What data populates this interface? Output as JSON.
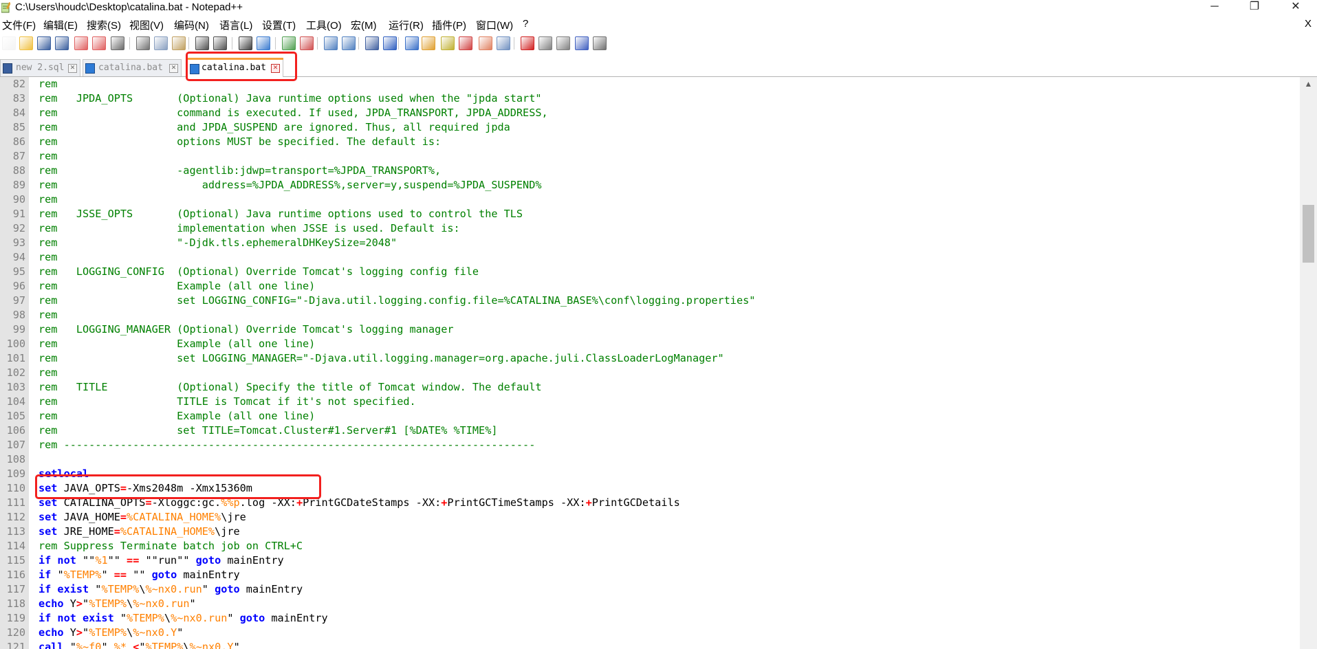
{
  "window": {
    "title": "C:\\Users\\houdc\\Desktop\\catalina.bat - Notepad++",
    "minimize": "─",
    "restore": "❐",
    "close": "✕"
  },
  "menu": {
    "items": [
      "文件(F)",
      "编辑(E)",
      "搜索(S)",
      "视图(V)",
      "编码(N)",
      "语言(L)",
      "设置(T)",
      "工具(O)",
      "宏(M)",
      "运行(R)",
      "插件(P)",
      "窗口(W)",
      "?"
    ],
    "close": "X"
  },
  "toolbar": {
    "icons": [
      {
        "name": "new-file-icon",
        "color": "#f4f4f4"
      },
      {
        "name": "open-file-icon",
        "color": "#f0c040"
      },
      {
        "name": "save-icon",
        "color": "#3a5f9e"
      },
      {
        "name": "save-all-icon",
        "color": "#3a5f9e"
      },
      {
        "name": "close-file-icon",
        "color": "#e06060"
      },
      {
        "name": "close-all-icon",
        "color": "#e06060"
      },
      {
        "name": "print-icon",
        "color": "#6a6a6a"
      },
      {
        "name": "cut-icon",
        "color": "#707070"
      },
      {
        "name": "copy-icon",
        "color": "#8aa0c0"
      },
      {
        "name": "paste-icon",
        "color": "#c0a060"
      },
      {
        "name": "undo-icon",
        "color": "#505050"
      },
      {
        "name": "redo-icon",
        "color": "#505050"
      },
      {
        "name": "find-icon",
        "color": "#404040"
      },
      {
        "name": "replace-icon",
        "color": "#3b7bd0"
      },
      {
        "name": "zoom-in-icon",
        "color": "#50a050"
      },
      {
        "name": "zoom-out-icon",
        "color": "#d05050"
      },
      {
        "name": "sync-vertical-icon",
        "color": "#5080c0"
      },
      {
        "name": "sync-horizontal-icon",
        "color": "#5080c0"
      },
      {
        "name": "word-wrap-icon",
        "color": "#4060a0"
      },
      {
        "name": "show-all-chars-icon",
        "color": "#3060c0"
      },
      {
        "name": "indent-guide-icon",
        "color": "#3a70c8"
      },
      {
        "name": "user-language-icon",
        "color": "#e0a030"
      },
      {
        "name": "doc-map-icon",
        "color": "#c0b030"
      },
      {
        "name": "function-list-icon",
        "color": "#d04040"
      },
      {
        "name": "folder-workspace-icon",
        "color": "#e08060"
      },
      {
        "name": "monitoring-icon",
        "color": "#7090c0"
      },
      {
        "name": "record-macro-icon",
        "color": "#d02020"
      },
      {
        "name": "stop-macro-icon",
        "color": "#808080"
      },
      {
        "name": "play-macro-icon",
        "color": "#808080"
      },
      {
        "name": "run-macro-multiple-icon",
        "color": "#4060c0"
      },
      {
        "name": "save-macro-icon",
        "color": "#707070"
      }
    ]
  },
  "tabs": [
    {
      "label": "new 2.sql",
      "active": false,
      "close": "✕"
    },
    {
      "label": "catalina.bat",
      "active": false,
      "close": "✕"
    },
    {
      "label": "catalina.bat",
      "active": true,
      "close": "✕"
    }
  ],
  "colors": {
    "comment": "#008000",
    "keyword": "#0000ff",
    "operator": "#ff0000",
    "variable": "#ff8000",
    "highlight_box": "#f2201e"
  },
  "editor": {
    "lines": [
      {
        "n": "82",
        "t": [
          [
            "c",
            "rem"
          ]
        ]
      },
      {
        "n": "83",
        "t": [
          [
            "c",
            "rem   JPDA_OPTS       (Optional) Java runtime options used when the \"jpda start\""
          ]
        ]
      },
      {
        "n": "84",
        "t": [
          [
            "c",
            "rem                   command is executed. If used, JPDA_TRANSPORT, JPDA_ADDRESS,"
          ]
        ]
      },
      {
        "n": "85",
        "t": [
          [
            "c",
            "rem                   and JPDA_SUSPEND are ignored. Thus, all required jpda"
          ]
        ]
      },
      {
        "n": "86",
        "t": [
          [
            "c",
            "rem                   options MUST be specified. The default is:"
          ]
        ]
      },
      {
        "n": "87",
        "t": [
          [
            "c",
            "rem"
          ]
        ]
      },
      {
        "n": "88",
        "t": [
          [
            "c",
            "rem                   -agentlib:jdwp=transport=%JPDA_TRANSPORT%,"
          ]
        ]
      },
      {
        "n": "89",
        "t": [
          [
            "c",
            "rem                       address=%JPDA_ADDRESS%,server=y,suspend=%JPDA_SUSPEND%"
          ]
        ]
      },
      {
        "n": "90",
        "t": [
          [
            "c",
            "rem"
          ]
        ]
      },
      {
        "n": "91",
        "t": [
          [
            "c",
            "rem   JSSE_OPTS       (Optional) Java runtime options used to control the TLS"
          ]
        ]
      },
      {
        "n": "92",
        "t": [
          [
            "c",
            "rem                   implementation when JSSE is used. Default is:"
          ]
        ]
      },
      {
        "n": "93",
        "t": [
          [
            "c",
            "rem                   \"-Djdk.tls.ephemeralDHKeySize=2048\""
          ]
        ]
      },
      {
        "n": "94",
        "t": [
          [
            "c",
            "rem"
          ]
        ]
      },
      {
        "n": "95",
        "t": [
          [
            "c",
            "rem   LOGGING_CONFIG  (Optional) Override Tomcat's logging config file"
          ]
        ]
      },
      {
        "n": "96",
        "t": [
          [
            "c",
            "rem                   Example (all one line)"
          ]
        ]
      },
      {
        "n": "97",
        "t": [
          [
            "c",
            "rem                   set LOGGING_CONFIG=\"-Djava.util.logging.config.file=%CATALINA_BASE%\\conf\\logging.properties\""
          ]
        ]
      },
      {
        "n": "98",
        "t": [
          [
            "c",
            "rem"
          ]
        ]
      },
      {
        "n": "99",
        "t": [
          [
            "c",
            "rem   LOGGING_MANAGER (Optional) Override Tomcat's logging manager"
          ]
        ]
      },
      {
        "n": "100",
        "t": [
          [
            "c",
            "rem                   Example (all one line)"
          ]
        ]
      },
      {
        "n": "101",
        "t": [
          [
            "c",
            "rem                   set LOGGING_MANAGER=\"-Djava.util.logging.manager=org.apache.juli.ClassLoaderLogManager\""
          ]
        ]
      },
      {
        "n": "102",
        "t": [
          [
            "c",
            "rem"
          ]
        ]
      },
      {
        "n": "103",
        "t": [
          [
            "c",
            "rem   TITLE           (Optional) Specify the title of Tomcat window. The default"
          ]
        ]
      },
      {
        "n": "104",
        "t": [
          [
            "c",
            "rem                   TITLE is Tomcat if it's not specified."
          ]
        ]
      },
      {
        "n": "105",
        "t": [
          [
            "c",
            "rem                   Example (all one line)"
          ]
        ]
      },
      {
        "n": "106",
        "t": [
          [
            "c",
            "rem                   set TITLE=Tomcat.Cluster#1.Server#1 [%DATE% %TIME%]"
          ]
        ]
      },
      {
        "n": "107",
        "t": [
          [
            "c",
            "rem ---------------------------------------------------------------------------"
          ]
        ]
      },
      {
        "n": "108",
        "t": []
      },
      {
        "n": "109",
        "t": [
          [
            "k",
            "setlocal"
          ]
        ]
      },
      {
        "n": "110",
        "t": [
          [
            "k",
            "set"
          ],
          [
            "x",
            " JAVA_OPTS"
          ],
          [
            "o",
            "="
          ],
          [
            "x",
            "-Xms2048m -Xmx15360m"
          ]
        ]
      },
      {
        "n": "111",
        "t": [
          [
            "k",
            "set"
          ],
          [
            "x",
            " CATALINA_OPTS"
          ],
          [
            "o",
            "="
          ],
          [
            "x",
            "-Xloggc:gc."
          ],
          [
            "v",
            "%%p"
          ],
          [
            "x",
            ".log -XX:"
          ],
          [
            "o",
            "+"
          ],
          [
            "x",
            "PrintGCDateStamps -XX:"
          ],
          [
            "o",
            "+"
          ],
          [
            "x",
            "PrintGCTimeStamps -XX:"
          ],
          [
            "o",
            "+"
          ],
          [
            "x",
            "PrintGCDetails"
          ]
        ]
      },
      {
        "n": "112",
        "t": [
          [
            "k",
            "set"
          ],
          [
            "x",
            " JAVA_HOME"
          ],
          [
            "o",
            "="
          ],
          [
            "v",
            "%CATALINA_HOME%"
          ],
          [
            "x",
            "\\jre"
          ]
        ]
      },
      {
        "n": "113",
        "t": [
          [
            "k",
            "set"
          ],
          [
            "x",
            " JRE_HOME"
          ],
          [
            "o",
            "="
          ],
          [
            "v",
            "%CATALINA_HOME%"
          ],
          [
            "x",
            "\\jre"
          ]
        ]
      },
      {
        "n": "114",
        "t": [
          [
            "c",
            "rem Suppress Terminate batch job on CTRL+C"
          ]
        ]
      },
      {
        "n": "115",
        "t": [
          [
            "k",
            "if not"
          ],
          [
            "x",
            " \"\""
          ],
          [
            "v",
            "%1"
          ],
          [
            "x",
            "\"\" "
          ],
          [
            "o",
            "=="
          ],
          [
            "x",
            " \"\"run\"\" "
          ],
          [
            "k",
            "goto"
          ],
          [
            "x",
            " mainEntry"
          ]
        ]
      },
      {
        "n": "116",
        "t": [
          [
            "k",
            "if"
          ],
          [
            "x",
            " \""
          ],
          [
            "v",
            "%TEMP%"
          ],
          [
            "x",
            "\" "
          ],
          [
            "o",
            "=="
          ],
          [
            "x",
            " \"\" "
          ],
          [
            "k",
            "goto"
          ],
          [
            "x",
            " mainEntry"
          ]
        ]
      },
      {
        "n": "117",
        "t": [
          [
            "k",
            "if exist"
          ],
          [
            "x",
            " \""
          ],
          [
            "v",
            "%TEMP%"
          ],
          [
            "x",
            "\\"
          ],
          [
            "v",
            "%~nx0.run"
          ],
          [
            "x",
            "\" "
          ],
          [
            "k",
            "goto"
          ],
          [
            "x",
            " mainEntry"
          ]
        ]
      },
      {
        "n": "118",
        "t": [
          [
            "k",
            "echo"
          ],
          [
            "x",
            " Y"
          ],
          [
            "o",
            ">"
          ],
          [
            "x",
            "\""
          ],
          [
            "v",
            "%TEMP%"
          ],
          [
            "x",
            "\\"
          ],
          [
            "v",
            "%~nx0.run"
          ],
          [
            "x",
            "\""
          ]
        ]
      },
      {
        "n": "119",
        "t": [
          [
            "k",
            "if not exist"
          ],
          [
            "x",
            " \""
          ],
          [
            "v",
            "%TEMP%"
          ],
          [
            "x",
            "\\"
          ],
          [
            "v",
            "%~nx0.run"
          ],
          [
            "x",
            "\" "
          ],
          [
            "k",
            "goto"
          ],
          [
            "x",
            " mainEntry"
          ]
        ]
      },
      {
        "n": "120",
        "t": [
          [
            "k",
            "echo"
          ],
          [
            "x",
            " Y"
          ],
          [
            "o",
            ">"
          ],
          [
            "x",
            "\""
          ],
          [
            "v",
            "%TEMP%"
          ],
          [
            "x",
            "\\"
          ],
          [
            "v",
            "%~nx0.Y"
          ],
          [
            "x",
            "\""
          ]
        ]
      },
      {
        "n": "121",
        "t": [
          [
            "k",
            "call"
          ],
          [
            "x",
            " \""
          ],
          [
            "v",
            "%~f0"
          ],
          [
            "x",
            "\" "
          ],
          [
            "v",
            "%*"
          ],
          [
            "x",
            " "
          ],
          [
            "o",
            "<"
          ],
          [
            "x",
            "\""
          ],
          [
            "v",
            "%TEMP%"
          ],
          [
            "x",
            "\\"
          ],
          [
            "v",
            "%~nx0.Y"
          ],
          [
            "x",
            "\""
          ]
        ]
      }
    ]
  }
}
